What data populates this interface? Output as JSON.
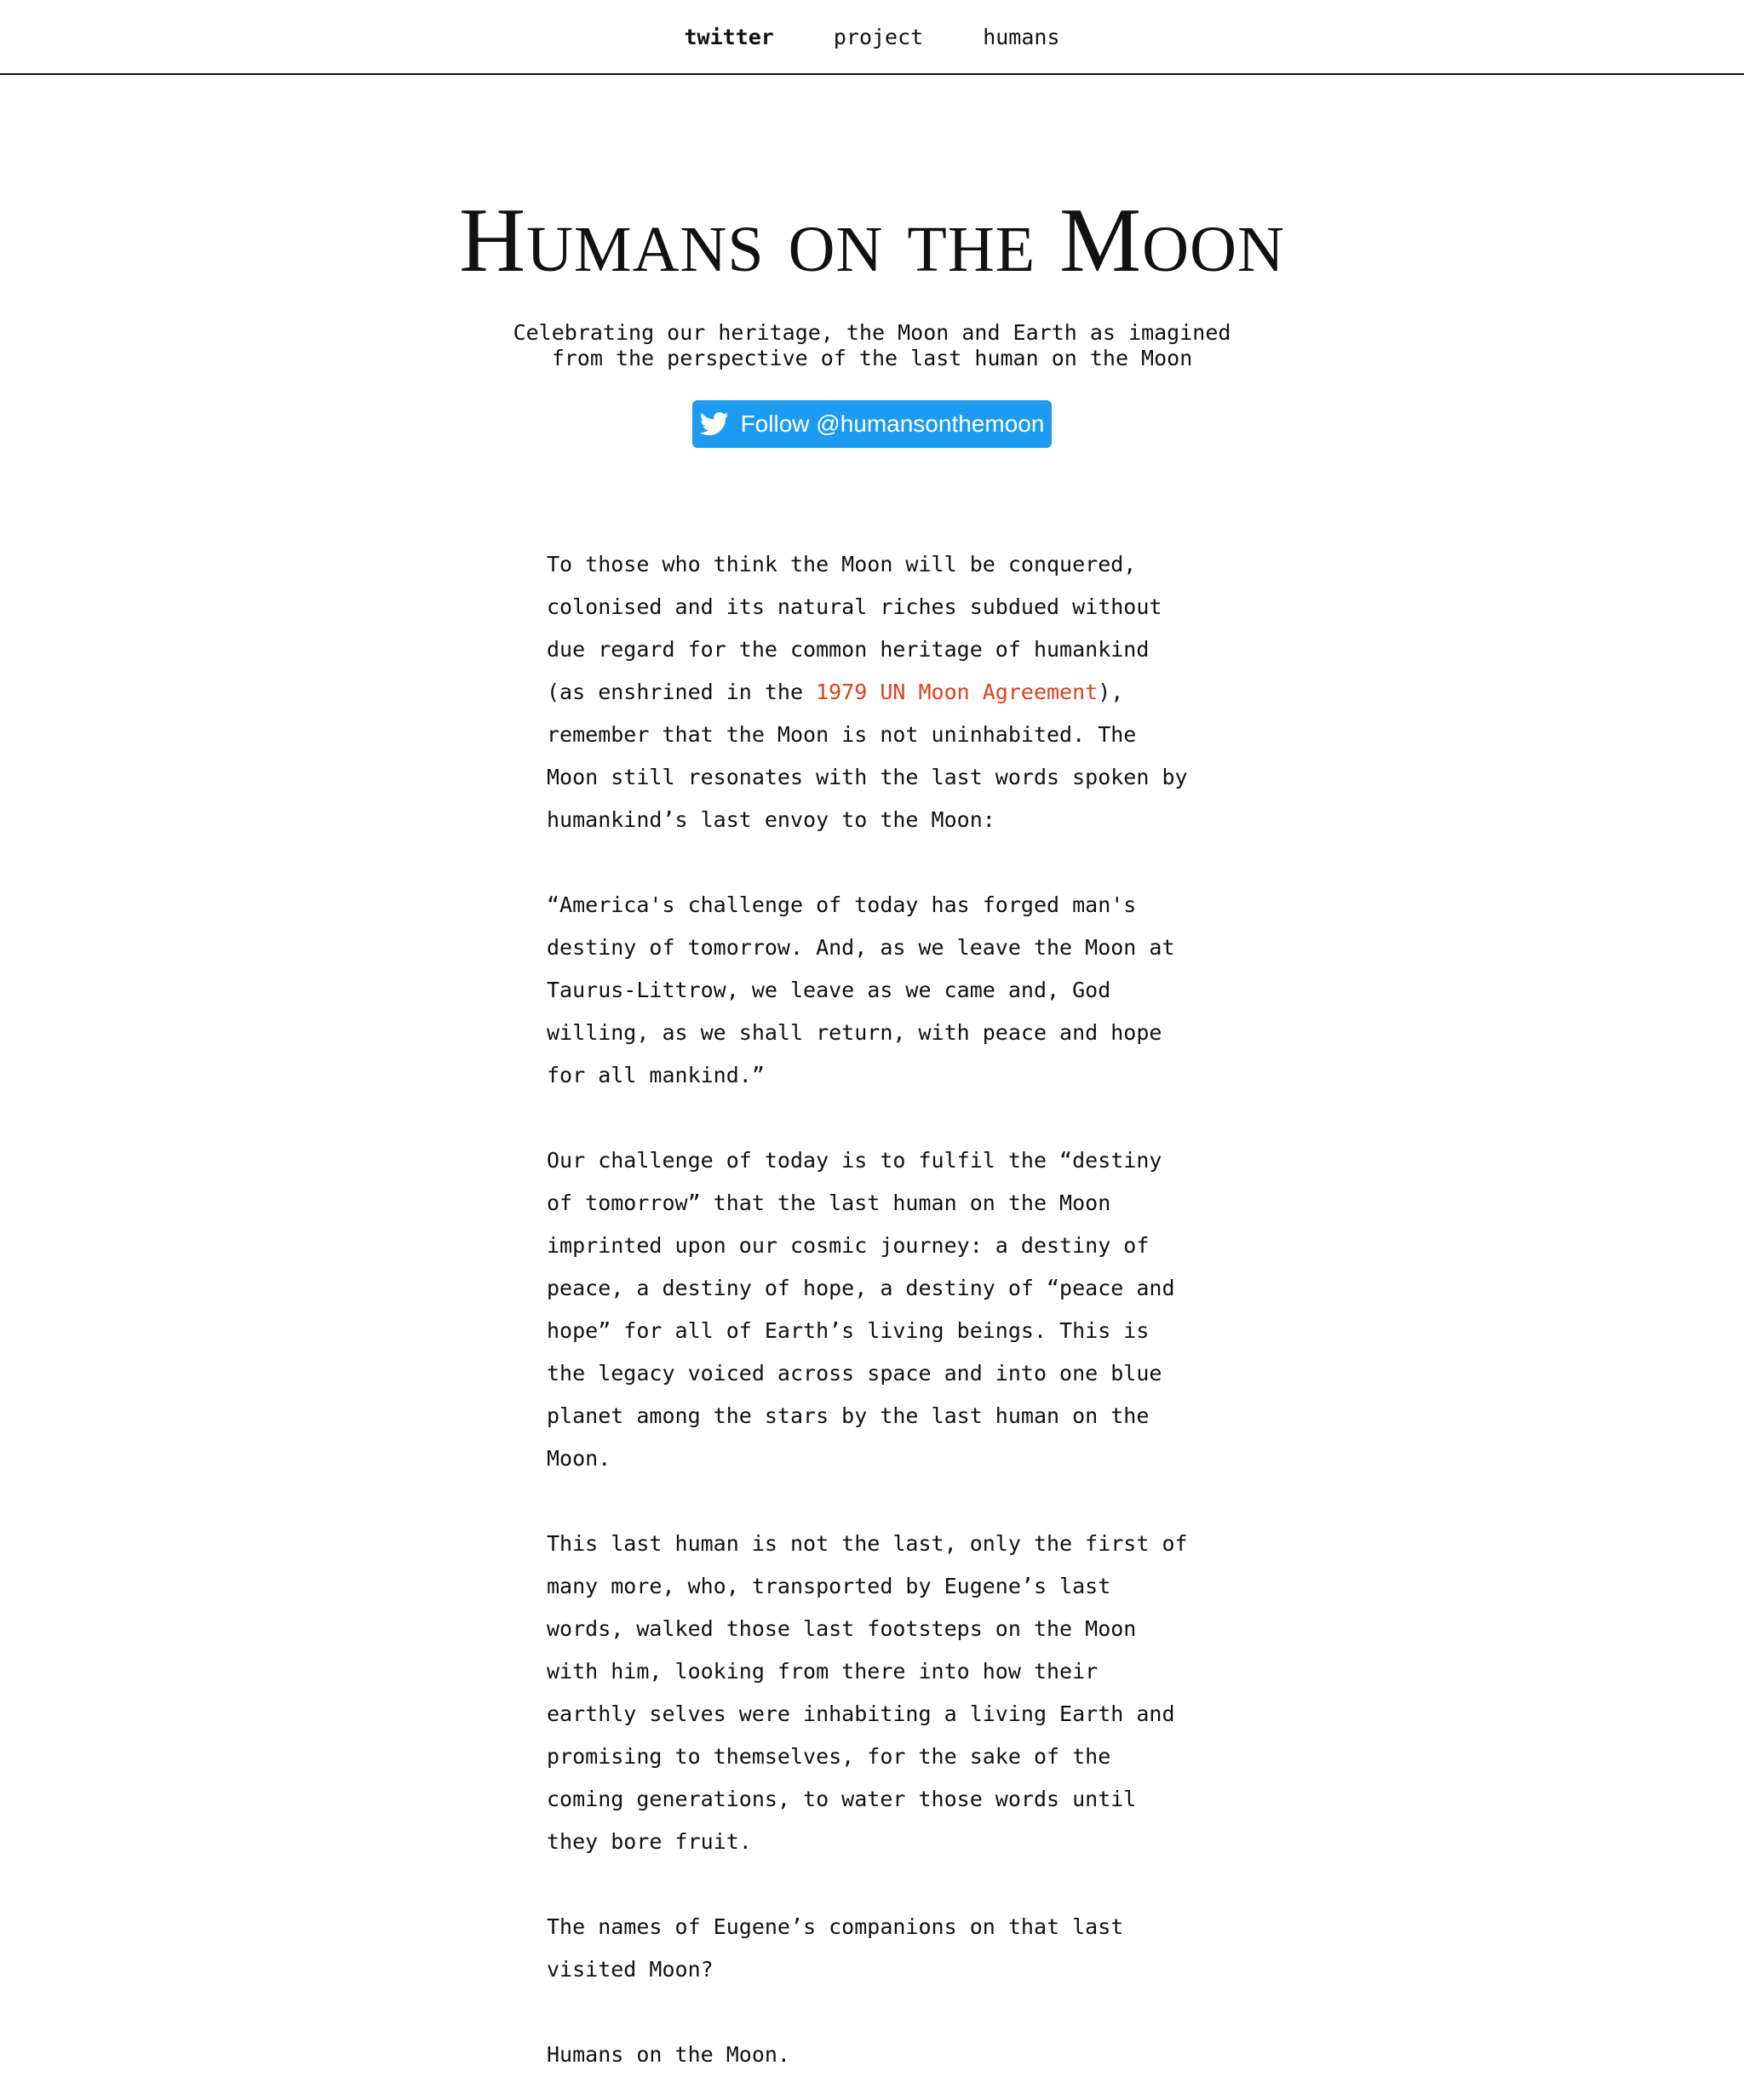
{
  "nav": {
    "items": [
      {
        "label": "twitter",
        "active": true
      },
      {
        "label": "project",
        "active": false
      },
      {
        "label": "humans",
        "active": false
      }
    ]
  },
  "hero": {
    "title": "Humans on the Moon",
    "tagline_line1": "Celebrating our heritage, the Moon and Earth as imagined",
    "tagline_line2": "from the perspective of the last human on the Moon",
    "follow_button": {
      "icon": "twitter-bird-icon",
      "label": "Follow @humansonthemoon",
      "color": "#1d9bf0"
    }
  },
  "content": {
    "link_color": "#e0401c",
    "p1": {
      "before": "To those who think the Moon will be conquered, colonised and its natural riches subdued without due regard for the common heritage of humankind (as enshrined in the ",
      "link": "1979 UN Moon Agreement",
      "after": "), remember that the Moon is not uninhabited. The Moon still resonates with the last words spoken by humankind’s last envoy to the Moon:"
    },
    "p2": "“America's challenge of today has forged man's destiny of tomorrow. And, as we leave the Moon at Taurus-Littrow, we leave as we came and, God willing, as we shall return, with peace and hope for all mankind.”",
    "p3": "Our challenge of today is to fulfil the “destiny of tomorrow” that the last human on the Moon imprinted upon our cosmic journey: a destiny of peace, a destiny of hope, a destiny of “peace and hope” for all of Earth’s living beings. This is the legacy voiced across space and into one blue planet among the stars by the last human on the Moon.",
    "p4": "This last human is not the last, only the first of many more, who, transported by Eugene’s last words, walked those last footsteps on the Moon with him, looking from there into how their earthly selves were inhabiting a living Earth and promising to themselves, for the sake of the coming generations, to water those words until they bore fruit.",
    "p5": "The names of Eugene’s companions on that last visited Moon?",
    "p6": "Humans on the Moon."
  }
}
